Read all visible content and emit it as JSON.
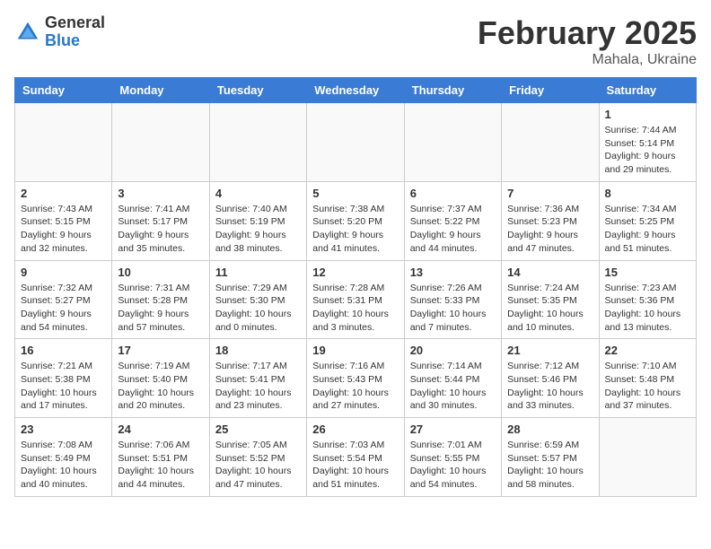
{
  "header": {
    "logo_general": "General",
    "logo_blue": "Blue",
    "month_title": "February 2025",
    "subtitle": "Mahala, Ukraine"
  },
  "days_of_week": [
    "Sunday",
    "Monday",
    "Tuesday",
    "Wednesday",
    "Thursday",
    "Friday",
    "Saturday"
  ],
  "weeks": [
    [
      {
        "day": "",
        "info": ""
      },
      {
        "day": "",
        "info": ""
      },
      {
        "day": "",
        "info": ""
      },
      {
        "day": "",
        "info": ""
      },
      {
        "day": "",
        "info": ""
      },
      {
        "day": "",
        "info": ""
      },
      {
        "day": "1",
        "info": "Sunrise: 7:44 AM\nSunset: 5:14 PM\nDaylight: 9 hours and 29 minutes."
      }
    ],
    [
      {
        "day": "2",
        "info": "Sunrise: 7:43 AM\nSunset: 5:15 PM\nDaylight: 9 hours and 32 minutes."
      },
      {
        "day": "3",
        "info": "Sunrise: 7:41 AM\nSunset: 5:17 PM\nDaylight: 9 hours and 35 minutes."
      },
      {
        "day": "4",
        "info": "Sunrise: 7:40 AM\nSunset: 5:19 PM\nDaylight: 9 hours and 38 minutes."
      },
      {
        "day": "5",
        "info": "Sunrise: 7:38 AM\nSunset: 5:20 PM\nDaylight: 9 hours and 41 minutes."
      },
      {
        "day": "6",
        "info": "Sunrise: 7:37 AM\nSunset: 5:22 PM\nDaylight: 9 hours and 44 minutes."
      },
      {
        "day": "7",
        "info": "Sunrise: 7:36 AM\nSunset: 5:23 PM\nDaylight: 9 hours and 47 minutes."
      },
      {
        "day": "8",
        "info": "Sunrise: 7:34 AM\nSunset: 5:25 PM\nDaylight: 9 hours and 51 minutes."
      }
    ],
    [
      {
        "day": "9",
        "info": "Sunrise: 7:32 AM\nSunset: 5:27 PM\nDaylight: 9 hours and 54 minutes."
      },
      {
        "day": "10",
        "info": "Sunrise: 7:31 AM\nSunset: 5:28 PM\nDaylight: 9 hours and 57 minutes."
      },
      {
        "day": "11",
        "info": "Sunrise: 7:29 AM\nSunset: 5:30 PM\nDaylight: 10 hours and 0 minutes."
      },
      {
        "day": "12",
        "info": "Sunrise: 7:28 AM\nSunset: 5:31 PM\nDaylight: 10 hours and 3 minutes."
      },
      {
        "day": "13",
        "info": "Sunrise: 7:26 AM\nSunset: 5:33 PM\nDaylight: 10 hours and 7 minutes."
      },
      {
        "day": "14",
        "info": "Sunrise: 7:24 AM\nSunset: 5:35 PM\nDaylight: 10 hours and 10 minutes."
      },
      {
        "day": "15",
        "info": "Sunrise: 7:23 AM\nSunset: 5:36 PM\nDaylight: 10 hours and 13 minutes."
      }
    ],
    [
      {
        "day": "16",
        "info": "Sunrise: 7:21 AM\nSunset: 5:38 PM\nDaylight: 10 hours and 17 minutes."
      },
      {
        "day": "17",
        "info": "Sunrise: 7:19 AM\nSunset: 5:40 PM\nDaylight: 10 hours and 20 minutes."
      },
      {
        "day": "18",
        "info": "Sunrise: 7:17 AM\nSunset: 5:41 PM\nDaylight: 10 hours and 23 minutes."
      },
      {
        "day": "19",
        "info": "Sunrise: 7:16 AM\nSunset: 5:43 PM\nDaylight: 10 hours and 27 minutes."
      },
      {
        "day": "20",
        "info": "Sunrise: 7:14 AM\nSunset: 5:44 PM\nDaylight: 10 hours and 30 minutes."
      },
      {
        "day": "21",
        "info": "Sunrise: 7:12 AM\nSunset: 5:46 PM\nDaylight: 10 hours and 33 minutes."
      },
      {
        "day": "22",
        "info": "Sunrise: 7:10 AM\nSunset: 5:48 PM\nDaylight: 10 hours and 37 minutes."
      }
    ],
    [
      {
        "day": "23",
        "info": "Sunrise: 7:08 AM\nSunset: 5:49 PM\nDaylight: 10 hours and 40 minutes."
      },
      {
        "day": "24",
        "info": "Sunrise: 7:06 AM\nSunset: 5:51 PM\nDaylight: 10 hours and 44 minutes."
      },
      {
        "day": "25",
        "info": "Sunrise: 7:05 AM\nSunset: 5:52 PM\nDaylight: 10 hours and 47 minutes."
      },
      {
        "day": "26",
        "info": "Sunrise: 7:03 AM\nSunset: 5:54 PM\nDaylight: 10 hours and 51 minutes."
      },
      {
        "day": "27",
        "info": "Sunrise: 7:01 AM\nSunset: 5:55 PM\nDaylight: 10 hours and 54 minutes."
      },
      {
        "day": "28",
        "info": "Sunrise: 6:59 AM\nSunset: 5:57 PM\nDaylight: 10 hours and 58 minutes."
      },
      {
        "day": "",
        "info": ""
      }
    ]
  ]
}
